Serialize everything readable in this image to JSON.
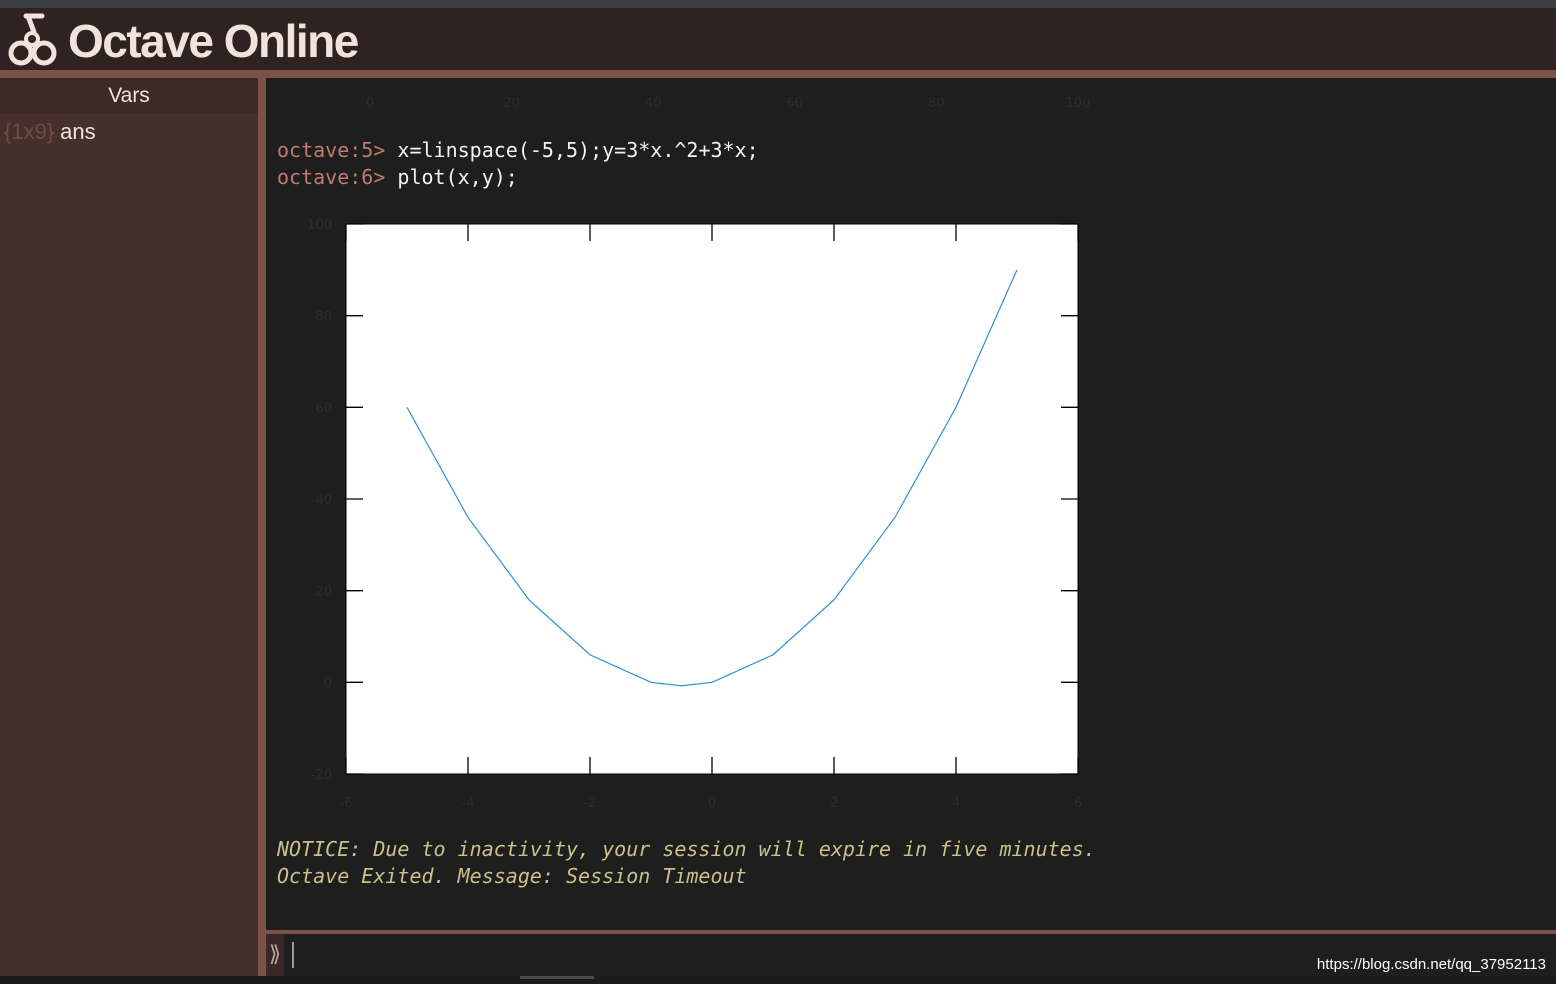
{
  "app": {
    "title": "Octave Online"
  },
  "sidebar": {
    "header": "Vars",
    "variables": [
      {
        "size": "{1x9}",
        "name": "ans"
      }
    ]
  },
  "console": {
    "previous_plot_x_ticks": [
      "0",
      "20",
      "40",
      "60",
      "80",
      "100"
    ],
    "lines": [
      {
        "prompt": "octave:5>",
        "command": " x=linspace(-5,5);y=3*x.^2+3*x;"
      },
      {
        "prompt": "octave:6>",
        "command": " plot(x,y);"
      }
    ],
    "notices": [
      "NOTICE: Due to inactivity, your session will expire in five minutes.",
      "Octave Exited. Message: Session Timeout"
    ]
  },
  "input": {
    "chevron": "⟫",
    "value": ""
  },
  "watermark": "https://blog.csdn.net/qq_37952113",
  "colors": {
    "line": "#2f8fd3",
    "prompt": "#c07a6e",
    "notice": "#c9c08a"
  },
  "chart_data": {
    "type": "line",
    "title": "",
    "xlabel": "",
    "ylabel": "",
    "xlim": [
      -6,
      6
    ],
    "ylim": [
      -20,
      100
    ],
    "xticks": [
      -6,
      -4,
      -2,
      0,
      2,
      4,
      6
    ],
    "yticks": [
      -20,
      0,
      20,
      40,
      60,
      80,
      100
    ],
    "grid": false,
    "series": [
      {
        "x": [
          -5,
          -4,
          -3,
          -2,
          -1,
          -0.5,
          0,
          1,
          2,
          3,
          4,
          5
        ],
        "y": [
          60,
          36,
          18,
          6,
          0,
          -0.75,
          0,
          6,
          18,
          36,
          60,
          90
        ]
      }
    ]
  }
}
